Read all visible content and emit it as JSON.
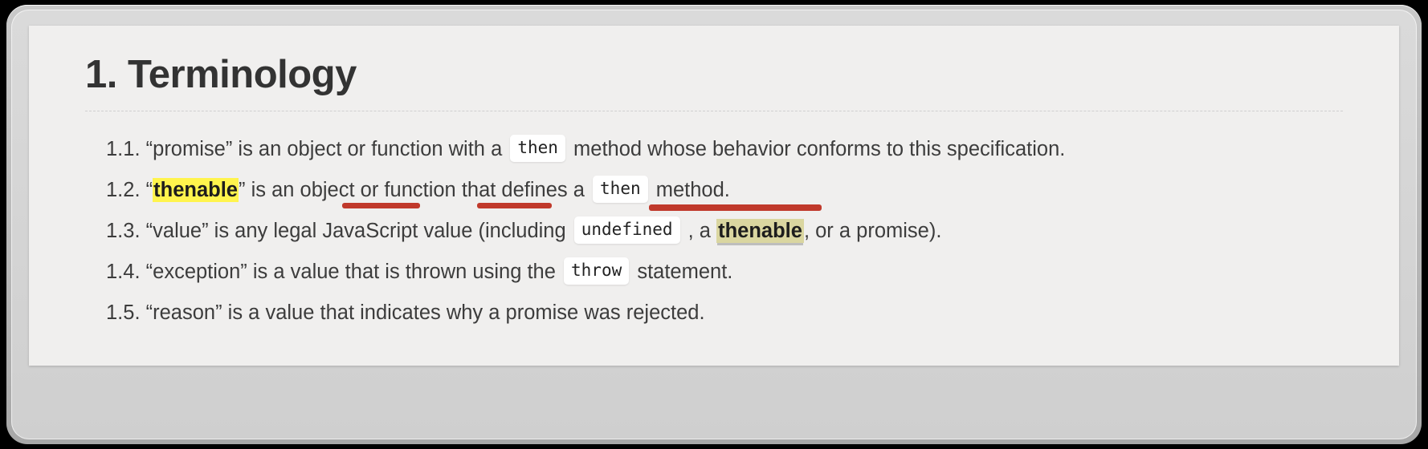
{
  "document": {
    "heading": "1. Terminology",
    "items": [
      {
        "number": "1.1.",
        "seg_a": "“promise” is an object or function with a",
        "code": "then",
        "seg_b": "method whose behavior conforms to this specification."
      },
      {
        "number": "1.2.",
        "quote_open": "“",
        "highlight": "thenable",
        "quote_close": "”",
        "seg_a": " is an object or function that defines a",
        "code": "then",
        "seg_b": "method."
      },
      {
        "number": "1.3.",
        "seg_a": "“value” is any legal JavaScript value (including",
        "code": "undefined",
        "seg_b": ", a",
        "highlight": "thenable",
        "seg_c": ", or a promise)."
      },
      {
        "number": "1.4.",
        "seg_a": "“exception” is a value that is thrown using the",
        "code": "throw",
        "seg_b": "statement."
      },
      {
        "number": "1.5.",
        "seg_a": "“reason” is a value that indicates why a promise was rejected."
      }
    ]
  },
  "annotations": {
    "underline_color": "#c0392b",
    "highlight_bright_color": "#fff44d",
    "highlight_dim_color": "#dad6a0",
    "marks": [
      {
        "id": "annot-1",
        "target": "an object"
      },
      {
        "id": "annot-2",
        "target": "function"
      },
      {
        "id": "annot-3",
        "target": "then method."
      }
    ]
  },
  "theme": {
    "page_background": "#f0efee",
    "text_color": "#3c3c3c",
    "heading_color": "#333333",
    "bezel_color": "#bdbdbd"
  }
}
